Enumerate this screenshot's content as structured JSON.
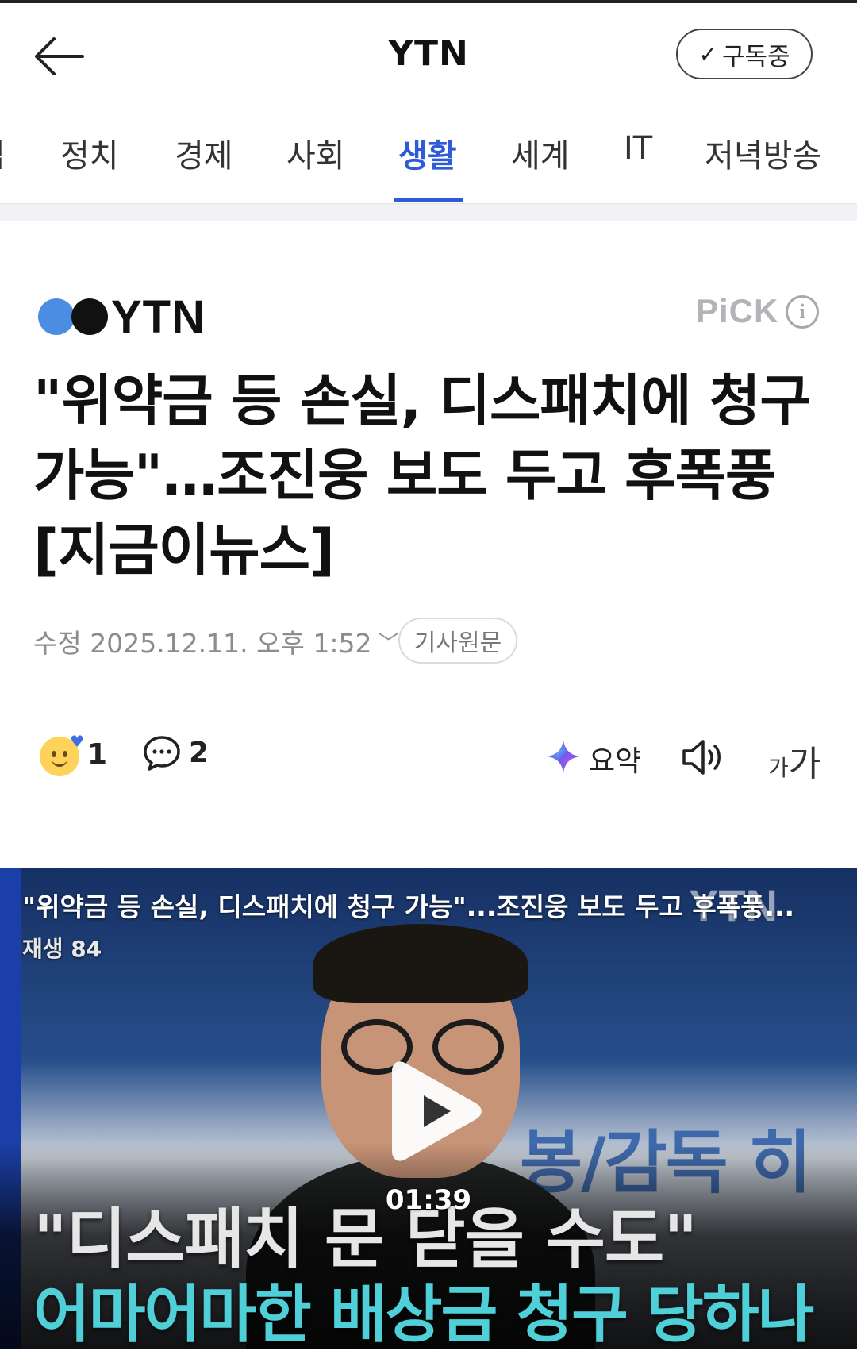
{
  "header": {
    "title": "YTN",
    "subscribe_label": "구독중",
    "subscribe_icon": "check-icon",
    "back_icon": "back-arrow-icon"
  },
  "tabs": [
    {
      "label": "집"
    },
    {
      "label": "정치"
    },
    {
      "label": "경제"
    },
    {
      "label": "사회"
    },
    {
      "label": "생활",
      "active": true
    },
    {
      "label": "세계"
    },
    {
      "label": "IT"
    },
    {
      "label": "저녁방송"
    }
  ],
  "article": {
    "press_name": "YTN",
    "pick_label": "PiCK",
    "info_icon": "info-icon",
    "headline": "\"위약금 등 손실, 디스패치에 청구 가능\"…조진웅 보도 두고 후폭풍 [지금이뉴스]",
    "modified_label": "수정 2025.12.11. 오후 1:52",
    "original_button": "기사원문"
  },
  "actions": {
    "reaction_count": "1",
    "comment_count": "2",
    "summary_label": "요약",
    "font_small": "가",
    "font_big": "가"
  },
  "video": {
    "title": "\"위약금 등 손실, 디스패치에 청구 가능\"...조진웅 보도 두고 후폭풍...",
    "views": "재생 84",
    "watermark": "YTN",
    "duration": "01:39",
    "background_text": "봉/감독 히",
    "caption_line1": "\"디스패치 문 닫을 수도\"",
    "caption_line2": "어마어마한 배상금 청구 당하나"
  },
  "colors": {
    "accent": "#2f5bd8",
    "caption_cyan": "#4fd0d8",
    "logo_blue": "#4a8de2"
  }
}
